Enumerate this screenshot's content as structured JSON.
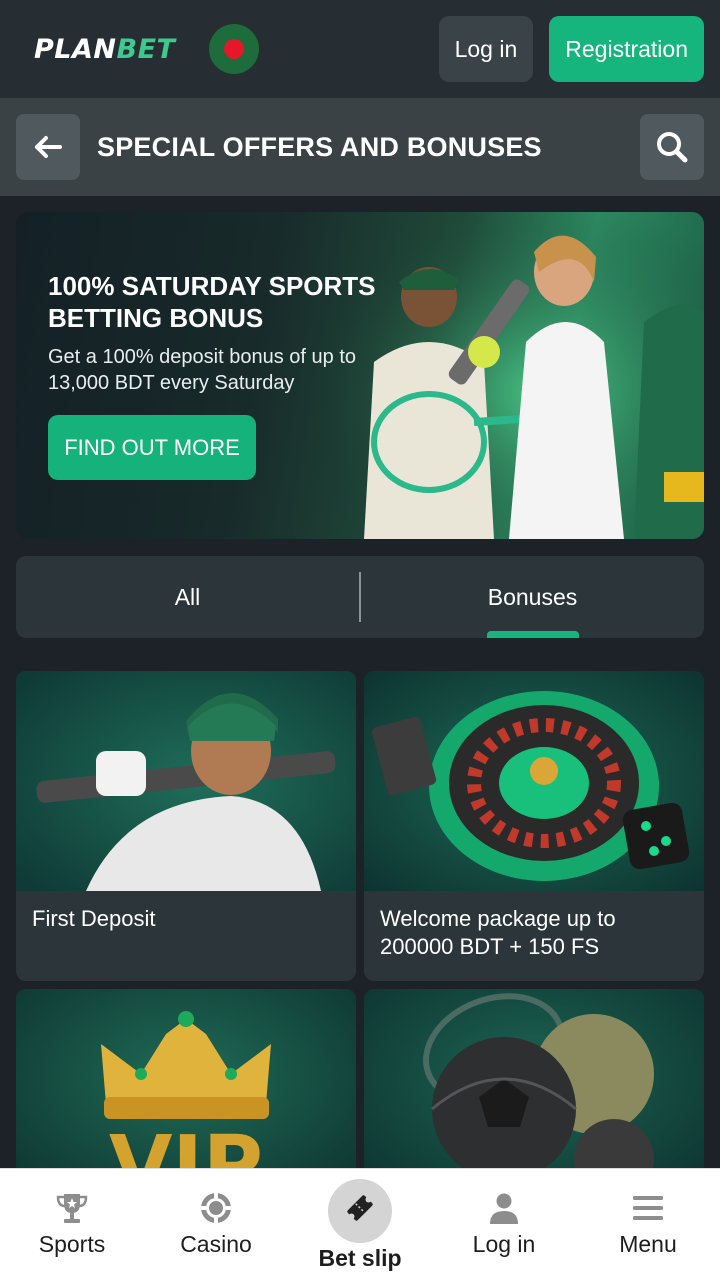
{
  "header": {
    "logo_plan": "PLAN",
    "logo_bet": "BET",
    "login_label": "Log in",
    "register_label": "Registration"
  },
  "subheader": {
    "title": "SPECIAL OFFERS AND BONUSES"
  },
  "banner": {
    "title": "100% SATURDAY SPORTS BETTING BONUS",
    "subtitle": "Get a 100% deposit bonus of up to 13,000 BDT every Saturday",
    "cta_label": "FIND OUT MORE"
  },
  "tabs": [
    {
      "label": "All",
      "active": false
    },
    {
      "label": "Bonuses",
      "active": true
    }
  ],
  "cards": [
    {
      "label": "First Deposit"
    },
    {
      "label": "Welcome package up to 200000 BDT + 150 FS"
    },
    {
      "label": "VIP"
    },
    {
      "label": ""
    }
  ],
  "bottom_nav": [
    {
      "label": "Sports",
      "icon": "trophy-icon"
    },
    {
      "label": "Casino",
      "icon": "casino-chip-icon"
    },
    {
      "label": "Bet slip",
      "icon": "ticket-icon"
    },
    {
      "label": "Log in",
      "icon": "user-icon"
    },
    {
      "label": "Menu",
      "icon": "menu-icon"
    }
  ],
  "colors": {
    "accent": "#17b57e",
    "background": "#1c2227",
    "flag_red": "#e5172b",
    "flag_green": "#1e6b3c"
  }
}
